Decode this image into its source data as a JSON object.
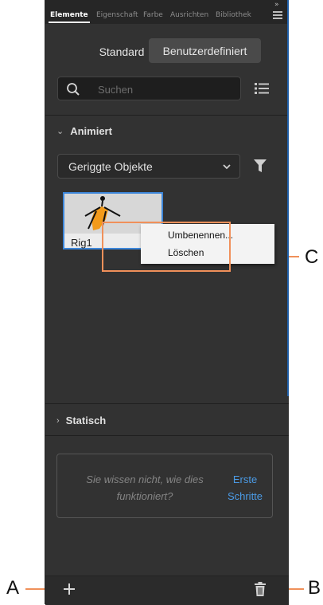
{
  "tabs": [
    {
      "label": "Elemente",
      "active": true
    },
    {
      "label": "Eigenschaft",
      "active": false
    },
    {
      "label": "Farbe",
      "active": false
    },
    {
      "label": "Ausrichten",
      "active": false
    },
    {
      "label": "Bibliothek",
      "active": false
    }
  ],
  "tabbar": {
    "collapse_icon": "»",
    "menu_icon": "hamburger-icon"
  },
  "toggle": {
    "standard": "Standard",
    "custom": "Benutzerdefiniert",
    "selected": "custom"
  },
  "search": {
    "placeholder": "Suchen",
    "value": "",
    "icon": "search-icon"
  },
  "list_view_icon": "list-view-icon",
  "animated": {
    "heading": "Animiert",
    "expanded": true,
    "filter": {
      "selected": "Geriggte Objekte",
      "icon": "filter-icon"
    },
    "items": [
      {
        "label": "Rig1",
        "selected": true
      }
    ]
  },
  "context_menu": {
    "items": [
      "Umbenennen...",
      "Löschen"
    ]
  },
  "static": {
    "heading": "Statisch",
    "expanded": false
  },
  "help": {
    "text_line1": "Sie wissen nicht, wie dies",
    "text_line2": "funktioniert?",
    "link_line1": "Erste",
    "link_line2": "Schritte"
  },
  "bottombar": {
    "add_icon": "plus-icon",
    "delete_icon": "trash-icon"
  },
  "callouts": {
    "a": "A",
    "b": "B",
    "c": "C"
  },
  "colors": {
    "panel": "#323232",
    "accent": "#3d86d9",
    "link": "#4b9be6",
    "callout": "#f0905a"
  }
}
